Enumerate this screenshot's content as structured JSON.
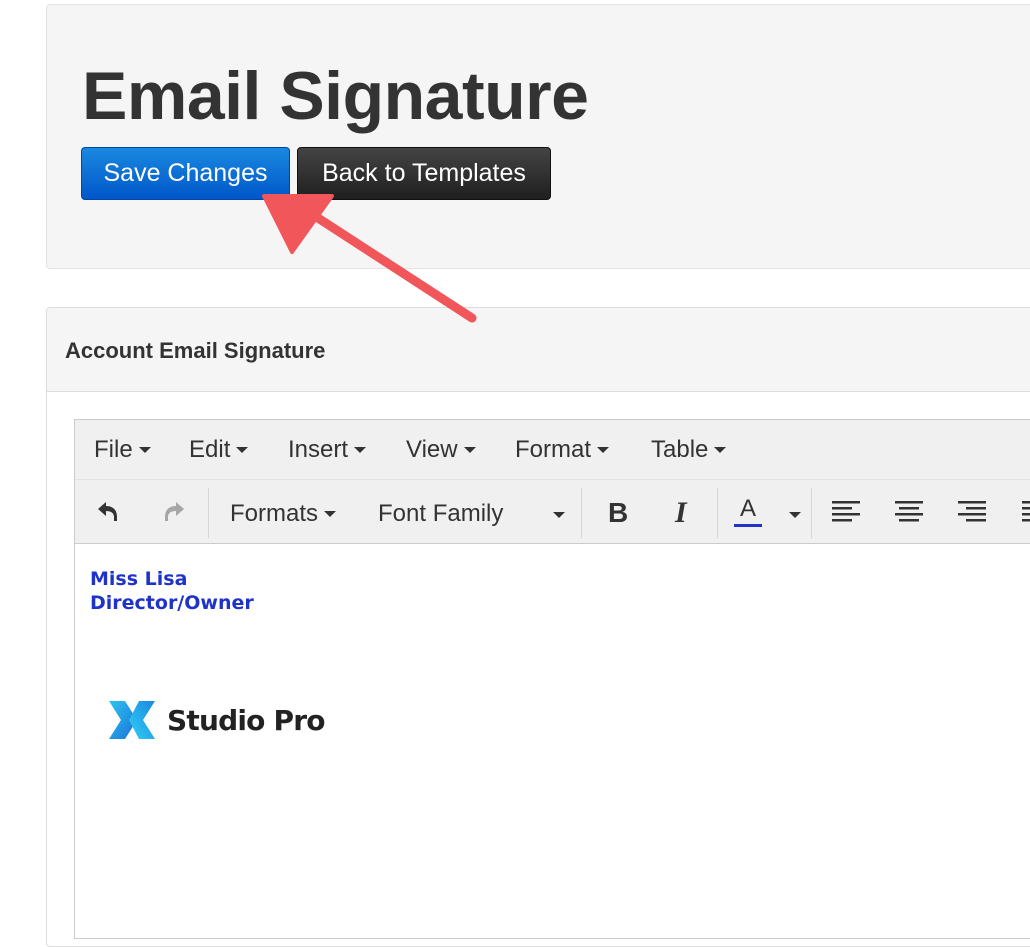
{
  "header": {
    "title": "Email Signature",
    "save_label": "Save Changes",
    "back_label": "Back to Templates"
  },
  "signature_panel": {
    "title": "Account Email Signature"
  },
  "editor": {
    "menubar": [
      {
        "label": "File"
      },
      {
        "label": "Edit"
      },
      {
        "label": "Insert"
      },
      {
        "label": "View"
      },
      {
        "label": "Format"
      },
      {
        "label": "Table"
      }
    ],
    "toolbar": {
      "formats_label": "Formats",
      "font_family_label": "Font Family",
      "text_color_letter": "A",
      "icons": [
        "undo-icon",
        "redo-icon",
        "bold-icon",
        "italic-icon",
        "text-color-icon",
        "align-left-icon",
        "align-center-icon",
        "align-right-icon",
        "justify-icon"
      ]
    },
    "content": {
      "line1": "Miss Lisa",
      "line2": "Director/Owner",
      "logo_text": "Studio Pro"
    }
  },
  "colors": {
    "primary_button": "#0a6fd8",
    "dark_button": "#2e2e2e",
    "signature_text": "#1f33c9",
    "annotation_arrow": "#f0565a"
  }
}
